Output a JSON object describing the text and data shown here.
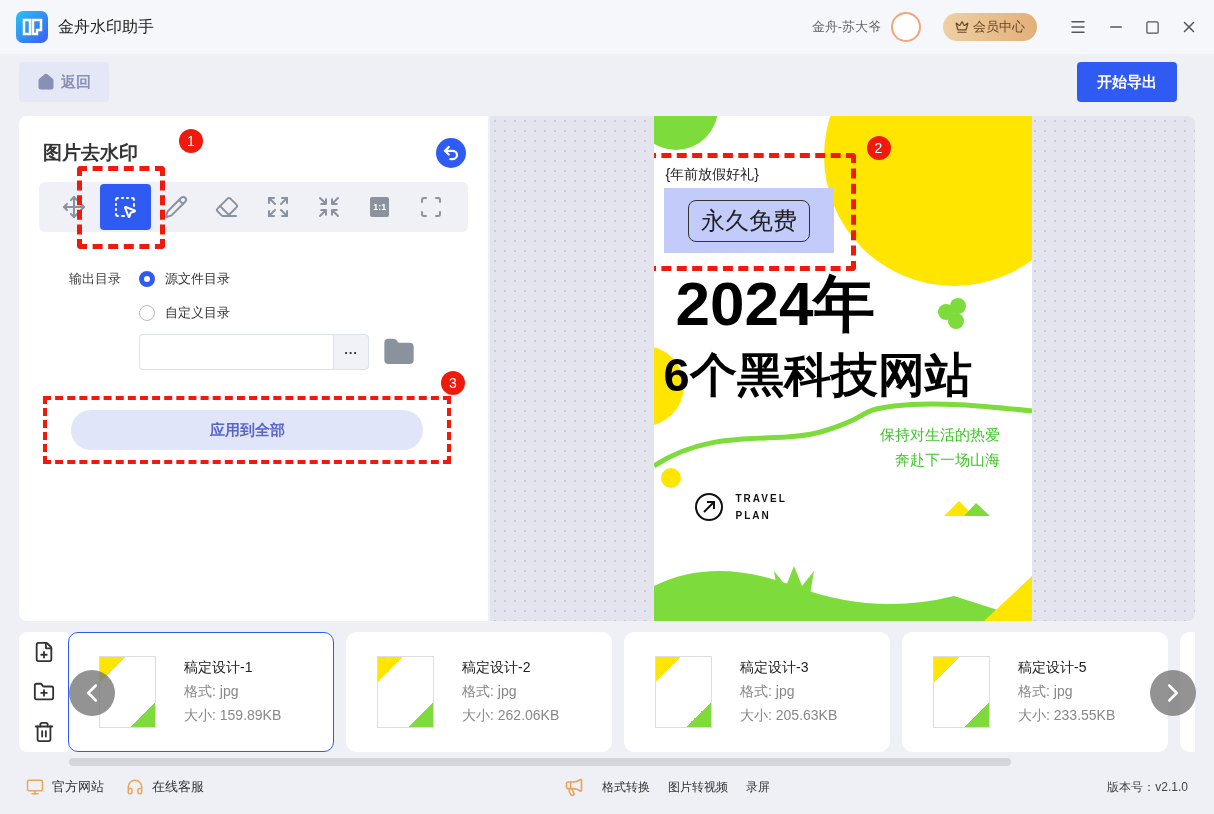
{
  "window": {
    "title": "金舟水印助手",
    "user": "金舟-苏大爷",
    "vip_button": "会员中心"
  },
  "toolbar": {
    "back": "返回",
    "export": "开始导出"
  },
  "panel": {
    "title": "图片去水印",
    "tools": [
      {
        "selected": false
      },
      {
        "selected": true
      },
      {
        "selected": false
      },
      {
        "selected": false
      },
      {
        "selected": false
      },
      {
        "selected": false
      },
      {
        "label": "1:1",
        "selected": false
      },
      {
        "selected": false
      }
    ],
    "output": {
      "label": "输出目录",
      "options": [
        {
          "label": "源文件目录",
          "selected": true
        },
        {
          "label": "自定义目录",
          "selected": false
        }
      ],
      "browse": "···"
    },
    "apply": "应用到全部"
  },
  "annotations": [
    "1",
    "2",
    "3"
  ],
  "preview": {
    "tag": "{年前放假好礼}",
    "badge": "永久免费",
    "headline": "2024年",
    "subheadline": "6个黑科技网站",
    "slogan": [
      "保持对生活的热爱",
      "奔赴下一场山海"
    ],
    "brand": [
      "TRAVEL",
      "PLAN"
    ]
  },
  "files": [
    {
      "name": "稿定设计-1",
      "format": "格式: jpg",
      "size": "大小: 159.89KB",
      "selected": true
    },
    {
      "name": "稿定设计-2",
      "format": "格式: jpg",
      "size": "大小: 262.06KB",
      "selected": false
    },
    {
      "name": "稿定设计-3",
      "format": "格式: jpg",
      "size": "大小: 205.63KB",
      "selected": false
    },
    {
      "name": "稿定设计-5",
      "format": "格式: jpg",
      "size": "大小: 233.55KB",
      "selected": false
    }
  ],
  "footer": {
    "links": [
      "官方网站",
      "在线客服"
    ],
    "tools": [
      "格式转换",
      "图片转视频",
      "录屏"
    ],
    "version": "版本号：v2.1.0"
  }
}
